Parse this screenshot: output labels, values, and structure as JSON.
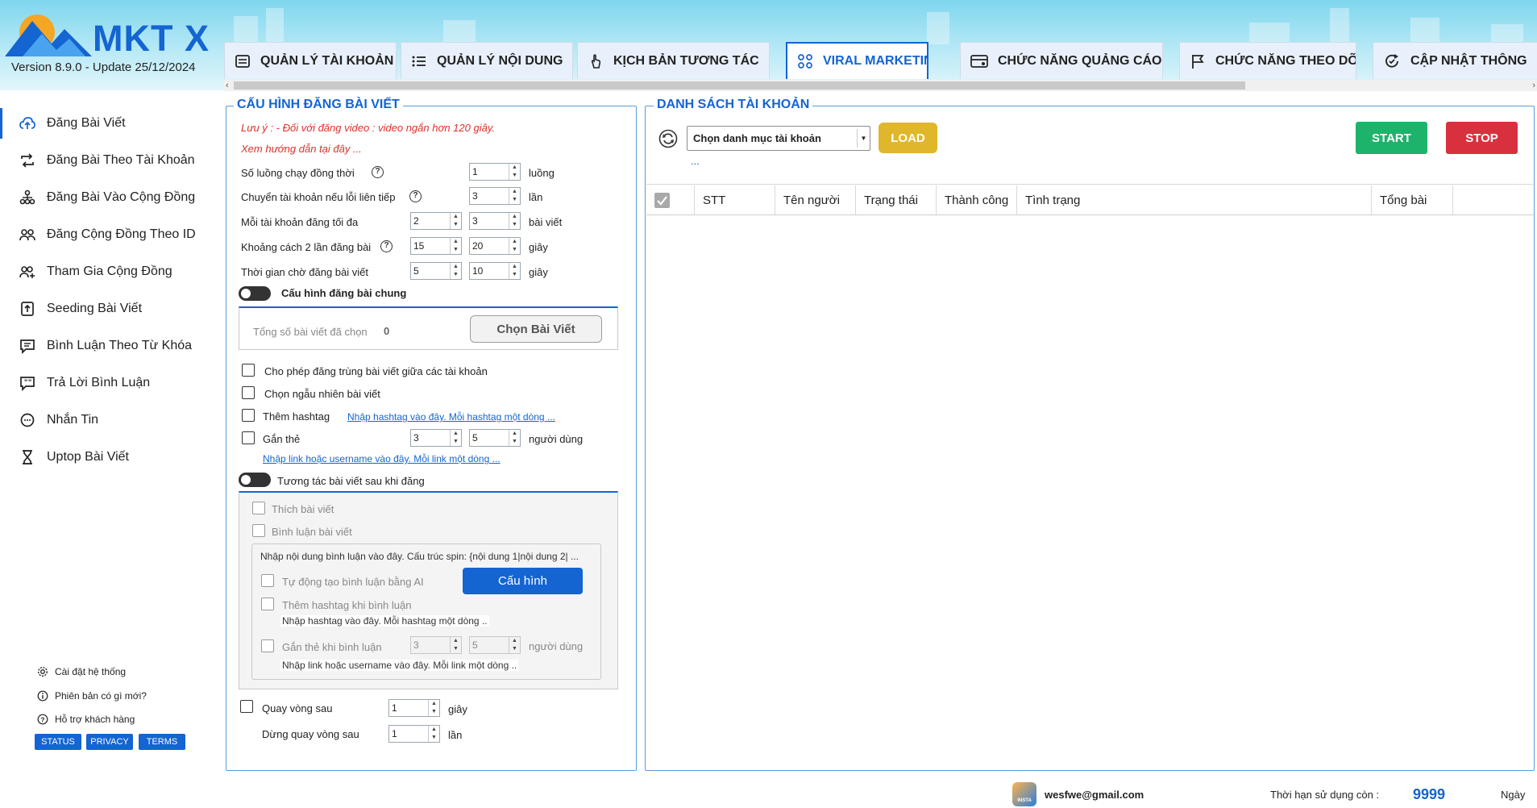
{
  "app": {
    "logo_text": "MKT X",
    "version": "Version  8.9.0  - Update  25/12/2024"
  },
  "tabs": [
    {
      "label": "QUẢN LÝ TÀI KHOẢN",
      "icon": "account-list-icon"
    },
    {
      "label": "QUẢN LÝ NỘI DUNG",
      "icon": "content-list-icon"
    },
    {
      "label": "KỊCH BẢN TƯƠNG TÁC",
      "icon": "touch-hand-icon"
    },
    {
      "label": "VIRAL MARKETING",
      "icon": "viral-grid-icon",
      "active": true
    },
    {
      "label": "CHỨC NĂNG QUẢNG CÁO",
      "icon": "ads-card-icon"
    },
    {
      "label": "CHỨC NĂNG THEO DÕI",
      "icon": "flag-icon"
    },
    {
      "label": "CẬP NHẬT THÔNG",
      "icon": "refresh-check-icon"
    }
  ],
  "sidebar": {
    "items": [
      {
        "label": "Đăng Bài Viết",
        "icon": "cloud-upload-icon",
        "active": true
      },
      {
        "label": "Đăng Bài Theo Tài Khoản",
        "icon": "repost-icon"
      },
      {
        "label": "Đăng Bài Vào Cộng Đồng",
        "icon": "group-tree-icon"
      },
      {
        "label": "Đăng Cộng Đồng Theo ID",
        "icon": "users-icon"
      },
      {
        "label": "Tham Gia Cộng Đồng",
        "icon": "join-users-icon"
      },
      {
        "label": "Seeding Bài Viết",
        "icon": "seeding-icon"
      },
      {
        "label": "Bình Luận Theo Từ Khóa",
        "icon": "comment-icon"
      },
      {
        "label": "Trả Lời Bình Luận",
        "icon": "reply-quote-icon"
      },
      {
        "label": "Nhắn Tin",
        "icon": "message-icon"
      },
      {
        "label": "Uptop Bài Viết",
        "icon": "hourglass-icon"
      }
    ],
    "footer": [
      {
        "label": "Cài đặt hệ thống",
        "icon": "gear-icon"
      },
      {
        "label": "Phiên bản có gì mới?",
        "icon": "info-icon"
      },
      {
        "label": "Hỗ trợ khách hàng",
        "icon": "help-icon"
      }
    ],
    "pills": [
      "STATUS",
      "PRIVACY",
      "TERMS"
    ]
  },
  "config": {
    "title": "CẤU HÌNH ĐĂNG BÀI VIẾT",
    "note1": "Lưu ý : - Đối với đăng video : video ngắn hơn 120 giây.",
    "note2": "Xem hướng dẫn tại đây ...",
    "threads_label": "Số luồng chạy đồng thời",
    "threads_value": "1",
    "threads_unit": "luồng",
    "switch_label": "Chuyển tài khoản nếu lỗi liên tiếp",
    "switch_value": "3",
    "switch_unit": "lần",
    "max_label": "Mỗi tài khoản đăng tối đa",
    "max_from": "2",
    "max_to": "3",
    "max_unit": "bài viết",
    "gap_label": "Khoảng cách 2 lần đăng bài",
    "gap_from": "15",
    "gap_to": "20",
    "gap_unit": "giây",
    "wait_label": "Thời gian chờ đăng bài viết",
    "wait_from": "5",
    "wait_to": "10",
    "wait_unit": "giây",
    "common_toggle": "Cấu hình đăng bài chung",
    "total_label": "Tổng số bài viết đã chọn",
    "total_value": "0",
    "choose_button": "Chọn Bài Viết",
    "allow_dup": "Cho phép đăng trùng bài viết giữa các tài khoản",
    "random": "Chọn ngẫu nhiên bài viết",
    "hashtag_label": "Thêm hashtag",
    "hashtag_link": "Nhập hashtag vào đây. Mỗi hashtag một dòng ...",
    "tag_label": "Gắn thẻ",
    "tag_from": "3",
    "tag_to": "5",
    "tag_unit": "người dùng",
    "tag_link": "Nhập link hoặc username vào đây. Mỗi link một dòng ...",
    "interact_toggle": "Tương tác bài viết sau khi đăng",
    "like": "Thích bài viết",
    "comment": "Bình luận bài viết",
    "comment_input": "Nhập nội dung bình luận vào đây. Cấu trúc spin: {nội dung 1|nội dung 2| ...",
    "ai_comment": "Tự động tạo bình luận bằng AI",
    "config_button": "Cấu hình",
    "comment_hashtag": "Thêm hashtag khi bình luận",
    "comment_hashtag_hint": "Nhập hashtag vào đây. Mỗi hashtag một dòng ..",
    "comment_tag": "Gắn thẻ khi bình luận",
    "comment_tag_from": "3",
    "comment_tag_to": "5",
    "comment_tag_unit": "người dùng",
    "comment_tag_hint": "Nhập link hoặc username vào đây. Mỗi link một dòng ..",
    "loop_label": "Quay vòng sau",
    "loop_value": "1",
    "loop_unit": "giây",
    "stop_loop_label": "Dừng quay vòng sau",
    "stop_loop_value": "1",
    "stop_loop_unit": "lần"
  },
  "accounts": {
    "title": "DANH SÁCH TÀI KHOẢN",
    "category_placeholder": "Chọn danh mục tài khoản",
    "load_button": "LOAD",
    "dots": "...",
    "start_button": "START",
    "stop_button": "STOP",
    "columns": [
      "STT",
      "Tên người",
      "Trạng thái",
      "Thành công",
      "Tình trạng",
      "Tổng bài"
    ]
  },
  "footer": {
    "email": "wesfwe@gmail.com",
    "expiry_label": "Thời hạn sử dụng còn :",
    "expiry_value": "9999",
    "expiry_unit": "Ngày",
    "badge_text": "INSTA"
  },
  "colors": {
    "accent": "#1464d2",
    "start": "#1db36b",
    "stop": "#d9303e",
    "load": "#e0b62a",
    "note": "#e0302c"
  }
}
